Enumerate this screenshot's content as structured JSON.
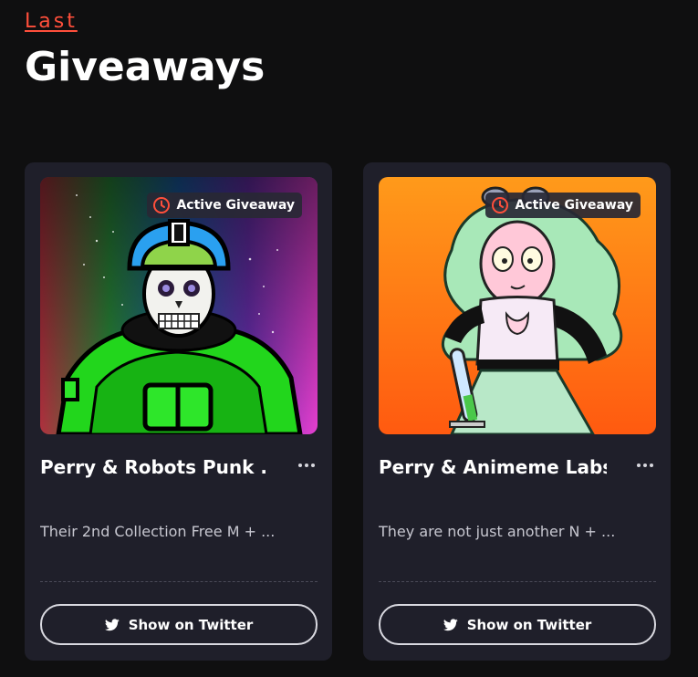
{
  "header": {
    "eyebrow": "Last",
    "title": "Giveaways"
  },
  "cards": [
    {
      "badge": "Active Giveaway",
      "name": "Perry & Robots Punk ...",
      "description": "Their 2nd Collection Free M + ...",
      "button": "Show on Twitter"
    },
    {
      "badge": "Active Giveaway",
      "name": "Perry & Animeme Labs...",
      "description": "They are not just another N + ...",
      "button": "Show on Twitter"
    }
  ],
  "colors": {
    "background": "#0f0f10",
    "card": "#1f1f2a",
    "accent": "#ff4f3b"
  },
  "icons": {
    "badge": "clock-icon",
    "menu": "more-horizontal-icon",
    "button": "twitter-icon"
  }
}
